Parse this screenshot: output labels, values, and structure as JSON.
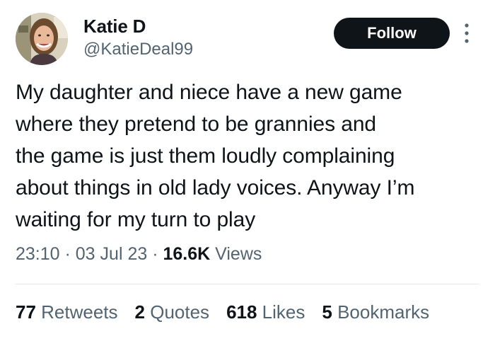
{
  "author": {
    "display_name": "Katie D",
    "handle": "@KatieDeal99"
  },
  "follow_button": {
    "label": "Follow"
  },
  "more_icon": "more-vertical-icon",
  "tweet": {
    "text": "My daughter and niece have a new game\nwhere they pretend to be grannies and\nthe game is just them loudly complaining\nabout things in old lady voices. Anyway I’m\nwaiting for my turn to play"
  },
  "meta": {
    "time": "23:10",
    "sep1": " · ",
    "date": "03 Jul 23",
    "sep2": " · ",
    "views_count": "16.6K",
    "views_label": " Views"
  },
  "stats": {
    "retweets": {
      "count": "77",
      "label": " Retweets"
    },
    "quotes": {
      "count": "2",
      "label": " Quotes"
    },
    "likes": {
      "count": "618",
      "label": " Likes"
    },
    "bookmarks": {
      "count": "5",
      "label": " Bookmarks"
    }
  },
  "colors": {
    "text_primary": "#0f1419",
    "text_secondary": "#536471",
    "follow_bg": "#0f1419",
    "divider": "#e6e9eb"
  }
}
